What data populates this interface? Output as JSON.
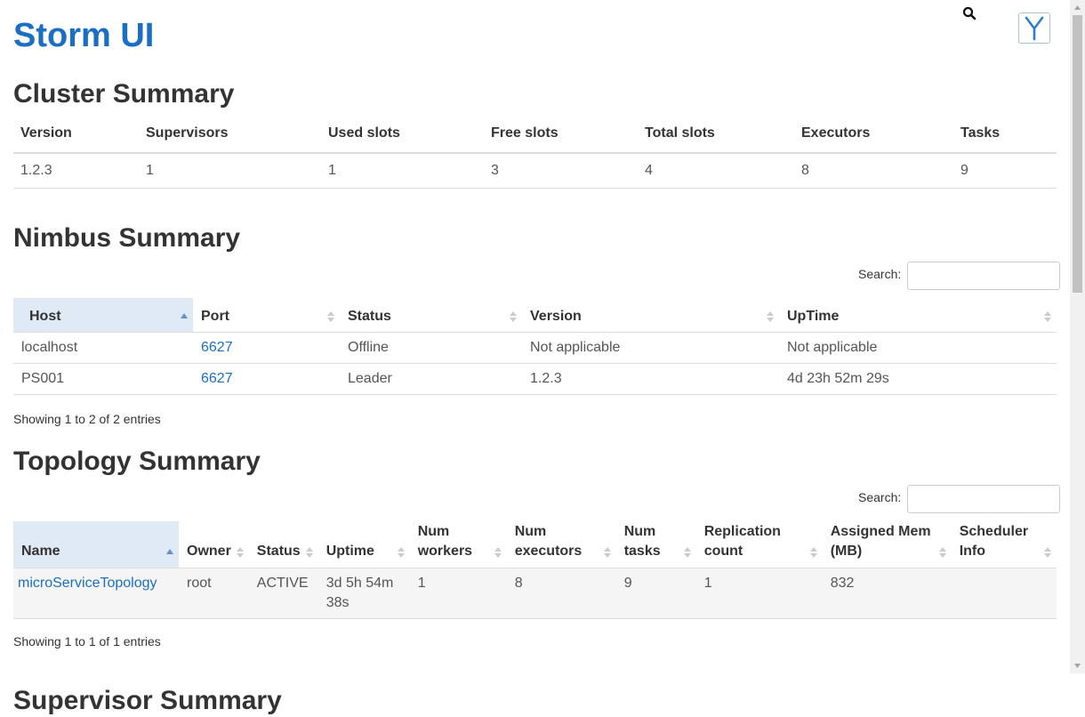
{
  "header": {
    "title": "Storm UI"
  },
  "cluster": {
    "title": "Cluster Summary",
    "columns": [
      "Version",
      "Supervisors",
      "Used slots",
      "Free slots",
      "Total slots",
      "Executors",
      "Tasks"
    ],
    "row": [
      "1.2.3",
      "1",
      "1",
      "3",
      "4",
      "8",
      "9"
    ]
  },
  "nimbus": {
    "title": "Nimbus Summary",
    "search_label": "Search:",
    "columns": [
      "Host",
      "Port",
      "Status",
      "Version",
      "UpTime"
    ],
    "rows": [
      [
        "localhost",
        "6627",
        "Offline",
        "Not applicable",
        "Not applicable"
      ],
      [
        "PS001",
        "6627",
        "Leader",
        "1.2.3",
        "4d 23h 52m 29s"
      ]
    ],
    "info": "Showing 1 to 2 of 2 entries"
  },
  "topology": {
    "title": "Topology Summary",
    "search_label": "Search:",
    "columns": [
      "Name",
      "Owner",
      "Status",
      "Uptime",
      "Num workers",
      "Num executors",
      "Num tasks",
      "Replication count",
      "Assigned Mem (MB)",
      "Scheduler Info"
    ],
    "rows": [
      [
        "microServiceTopology",
        "root",
        "ACTIVE",
        "3d 5h 54m 38s",
        "1",
        "8",
        "9",
        "1",
        "832",
        ""
      ]
    ],
    "info": "Showing 1 to 1 of 1 entries"
  },
  "next_section": {
    "title": "Supervisor Summary"
  },
  "icons": {
    "search": "search-icon",
    "logo": "yarn-logo-icon"
  },
  "colors": {
    "link": "#1a6fc4",
    "sorted_header": "#dfeaf5"
  }
}
